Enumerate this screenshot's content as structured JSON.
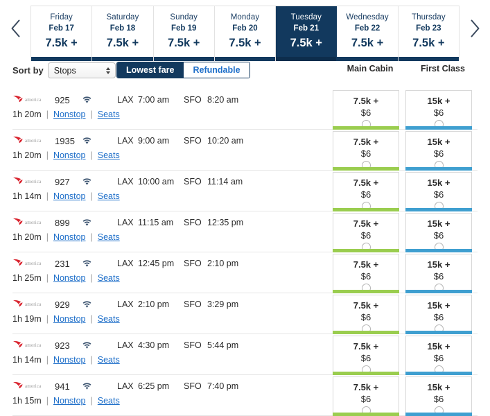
{
  "datestrip": {
    "prev_label": "Previous dates",
    "next_label": "Next dates",
    "days": [
      {
        "weekday": "Friday",
        "date": "Feb 17",
        "price": "7.5k +",
        "selected": false
      },
      {
        "weekday": "Saturday",
        "date": "Feb 18",
        "price": "7.5k +",
        "selected": false
      },
      {
        "weekday": "Sunday",
        "date": "Feb 19",
        "price": "7.5k +",
        "selected": false
      },
      {
        "weekday": "Monday",
        "date": "Feb 20",
        "price": "7.5k +",
        "selected": false
      },
      {
        "weekday": "Tuesday",
        "date": "Feb 21",
        "price": "7.5k +",
        "selected": true
      },
      {
        "weekday": "Wednesday",
        "date": "Feb 22",
        "price": "7.5k +",
        "selected": false
      },
      {
        "weekday": "Thursday",
        "date": "Feb 23",
        "price": "7.5k +",
        "selected": false
      }
    ]
  },
  "controls": {
    "sort_label": "Sort by",
    "sort_value": "Stops",
    "sort_options": [
      "Stops"
    ],
    "fare_filter": {
      "lowest_label": "Lowest fare",
      "refundable_label": "Refundable",
      "active": "Lowest fare"
    }
  },
  "cabins": [
    {
      "name": "Main Cabin",
      "accent": "#9acd4f"
    },
    {
      "name": "First Class",
      "accent": "#3f9fd0"
    }
  ],
  "row_links": {
    "stops_label": "Nonstop",
    "seats_label": "Seats",
    "divider": "|"
  },
  "airline": {
    "name": "america",
    "logo_color": "#d9232e"
  },
  "flights": [
    {
      "number": "925",
      "wifi": true,
      "origin": "LAX",
      "depart": "7:00 am",
      "destination": "SFO",
      "arrive": "8:20 am",
      "duration": "1h 20m",
      "stops": "Nonstop",
      "seats": "Seats",
      "fares": [
        {
          "cabin": "Main Cabin",
          "miles": "7.5k +",
          "cash": "$6",
          "selected": false
        },
        {
          "cabin": "First Class",
          "miles": "15k +",
          "cash": "$6",
          "selected": false
        }
      ]
    },
    {
      "number": "1935",
      "wifi": true,
      "origin": "LAX",
      "depart": "9:00 am",
      "destination": "SFO",
      "arrive": "10:20 am",
      "duration": "1h 20m",
      "stops": "Nonstop",
      "seats": "Seats",
      "fares": [
        {
          "cabin": "Main Cabin",
          "miles": "7.5k +",
          "cash": "$6",
          "selected": false
        },
        {
          "cabin": "First Class",
          "miles": "15k +",
          "cash": "$6",
          "selected": false
        }
      ]
    },
    {
      "number": "927",
      "wifi": true,
      "origin": "LAX",
      "depart": "10:00 am",
      "destination": "SFO",
      "arrive": "11:14 am",
      "duration": "1h 14m",
      "stops": "Nonstop",
      "seats": "Seats",
      "fares": [
        {
          "cabin": "Main Cabin",
          "miles": "7.5k +",
          "cash": "$6",
          "selected": false
        },
        {
          "cabin": "First Class",
          "miles": "15k +",
          "cash": "$6",
          "selected": false
        }
      ]
    },
    {
      "number": "899",
      "wifi": true,
      "origin": "LAX",
      "depart": "11:15 am",
      "destination": "SFO",
      "arrive": "12:35 pm",
      "duration": "1h 20m",
      "stops": "Nonstop",
      "seats": "Seats",
      "fares": [
        {
          "cabin": "Main Cabin",
          "miles": "7.5k +",
          "cash": "$6",
          "selected": false
        },
        {
          "cabin": "First Class",
          "miles": "15k +",
          "cash": "$6",
          "selected": false
        }
      ]
    },
    {
      "number": "231",
      "wifi": true,
      "origin": "LAX",
      "depart": "12:45 pm",
      "destination": "SFO",
      "arrive": "2:10 pm",
      "duration": "1h 25m",
      "stops": "Nonstop",
      "seats": "Seats",
      "fares": [
        {
          "cabin": "Main Cabin",
          "miles": "7.5k +",
          "cash": "$6",
          "selected": false
        },
        {
          "cabin": "First Class",
          "miles": "15k +",
          "cash": "$6",
          "selected": false
        }
      ]
    },
    {
      "number": "929",
      "wifi": true,
      "origin": "LAX",
      "depart": "2:10 pm",
      "destination": "SFO",
      "arrive": "3:29 pm",
      "duration": "1h 19m",
      "stops": "Nonstop",
      "seats": "Seats",
      "fares": [
        {
          "cabin": "Main Cabin",
          "miles": "7.5k +",
          "cash": "$6",
          "selected": false
        },
        {
          "cabin": "First Class",
          "miles": "15k +",
          "cash": "$6",
          "selected": false
        }
      ]
    },
    {
      "number": "923",
      "wifi": true,
      "origin": "LAX",
      "depart": "4:30 pm",
      "destination": "SFO",
      "arrive": "5:44 pm",
      "duration": "1h 14m",
      "stops": "Nonstop",
      "seats": "Seats",
      "fares": [
        {
          "cabin": "Main Cabin",
          "miles": "7.5k +",
          "cash": "$6",
          "selected": false
        },
        {
          "cabin": "First Class",
          "miles": "15k +",
          "cash": "$6",
          "selected": false
        }
      ]
    },
    {
      "number": "941",
      "wifi": true,
      "origin": "LAX",
      "depart": "6:25 pm",
      "destination": "SFO",
      "arrive": "7:40 pm",
      "duration": "1h 15m",
      "stops": "Nonstop",
      "seats": "Seats",
      "fares": [
        {
          "cabin": "Main Cabin",
          "miles": "7.5k +",
          "cash": "$6",
          "selected": false
        },
        {
          "cabin": "First Class",
          "miles": "15k +",
          "cash": "$6",
          "selected": false
        }
      ]
    }
  ],
  "theme": {
    "navy": "#12395e",
    "link_blue": "#1d6ec9",
    "main_cabin_accent": "#9acd4f",
    "first_class_accent": "#3f9fd0",
    "logo_red": "#d9232e"
  }
}
